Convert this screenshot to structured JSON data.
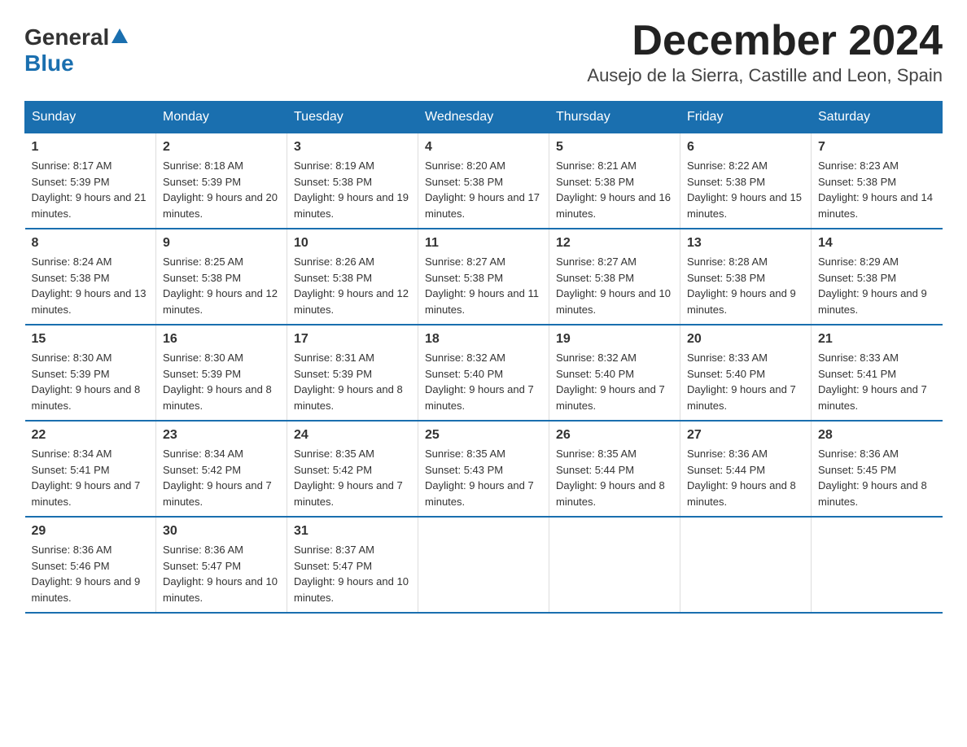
{
  "header": {
    "logo_general": "General",
    "logo_blue": "Blue",
    "month_title": "December 2024",
    "subtitle": "Ausejo de la Sierra, Castille and Leon, Spain"
  },
  "days_of_week": [
    "Sunday",
    "Monday",
    "Tuesday",
    "Wednesday",
    "Thursday",
    "Friday",
    "Saturday"
  ],
  "weeks": [
    [
      {
        "day": "1",
        "sunrise": "8:17 AM",
        "sunset": "5:39 PM",
        "daylight": "9 hours and 21 minutes."
      },
      {
        "day": "2",
        "sunrise": "8:18 AM",
        "sunset": "5:39 PM",
        "daylight": "9 hours and 20 minutes."
      },
      {
        "day": "3",
        "sunrise": "8:19 AM",
        "sunset": "5:38 PM",
        "daylight": "9 hours and 19 minutes."
      },
      {
        "day": "4",
        "sunrise": "8:20 AM",
        "sunset": "5:38 PM",
        "daylight": "9 hours and 17 minutes."
      },
      {
        "day": "5",
        "sunrise": "8:21 AM",
        "sunset": "5:38 PM",
        "daylight": "9 hours and 16 minutes."
      },
      {
        "day": "6",
        "sunrise": "8:22 AM",
        "sunset": "5:38 PM",
        "daylight": "9 hours and 15 minutes."
      },
      {
        "day": "7",
        "sunrise": "8:23 AM",
        "sunset": "5:38 PM",
        "daylight": "9 hours and 14 minutes."
      }
    ],
    [
      {
        "day": "8",
        "sunrise": "8:24 AM",
        "sunset": "5:38 PM",
        "daylight": "9 hours and 13 minutes."
      },
      {
        "day": "9",
        "sunrise": "8:25 AM",
        "sunset": "5:38 PM",
        "daylight": "9 hours and 12 minutes."
      },
      {
        "day": "10",
        "sunrise": "8:26 AM",
        "sunset": "5:38 PM",
        "daylight": "9 hours and 12 minutes."
      },
      {
        "day": "11",
        "sunrise": "8:27 AM",
        "sunset": "5:38 PM",
        "daylight": "9 hours and 11 minutes."
      },
      {
        "day": "12",
        "sunrise": "8:27 AM",
        "sunset": "5:38 PM",
        "daylight": "9 hours and 10 minutes."
      },
      {
        "day": "13",
        "sunrise": "8:28 AM",
        "sunset": "5:38 PM",
        "daylight": "9 hours and 9 minutes."
      },
      {
        "day": "14",
        "sunrise": "8:29 AM",
        "sunset": "5:38 PM",
        "daylight": "9 hours and 9 minutes."
      }
    ],
    [
      {
        "day": "15",
        "sunrise": "8:30 AM",
        "sunset": "5:39 PM",
        "daylight": "9 hours and 8 minutes."
      },
      {
        "day": "16",
        "sunrise": "8:30 AM",
        "sunset": "5:39 PM",
        "daylight": "9 hours and 8 minutes."
      },
      {
        "day": "17",
        "sunrise": "8:31 AM",
        "sunset": "5:39 PM",
        "daylight": "9 hours and 8 minutes."
      },
      {
        "day": "18",
        "sunrise": "8:32 AM",
        "sunset": "5:40 PM",
        "daylight": "9 hours and 7 minutes."
      },
      {
        "day": "19",
        "sunrise": "8:32 AM",
        "sunset": "5:40 PM",
        "daylight": "9 hours and 7 minutes."
      },
      {
        "day": "20",
        "sunrise": "8:33 AM",
        "sunset": "5:40 PM",
        "daylight": "9 hours and 7 minutes."
      },
      {
        "day": "21",
        "sunrise": "8:33 AM",
        "sunset": "5:41 PM",
        "daylight": "9 hours and 7 minutes."
      }
    ],
    [
      {
        "day": "22",
        "sunrise": "8:34 AM",
        "sunset": "5:41 PM",
        "daylight": "9 hours and 7 minutes."
      },
      {
        "day": "23",
        "sunrise": "8:34 AM",
        "sunset": "5:42 PM",
        "daylight": "9 hours and 7 minutes."
      },
      {
        "day": "24",
        "sunrise": "8:35 AM",
        "sunset": "5:42 PM",
        "daylight": "9 hours and 7 minutes."
      },
      {
        "day": "25",
        "sunrise": "8:35 AM",
        "sunset": "5:43 PM",
        "daylight": "9 hours and 7 minutes."
      },
      {
        "day": "26",
        "sunrise": "8:35 AM",
        "sunset": "5:44 PM",
        "daylight": "9 hours and 8 minutes."
      },
      {
        "day": "27",
        "sunrise": "8:36 AM",
        "sunset": "5:44 PM",
        "daylight": "9 hours and 8 minutes."
      },
      {
        "day": "28",
        "sunrise": "8:36 AM",
        "sunset": "5:45 PM",
        "daylight": "9 hours and 8 minutes."
      }
    ],
    [
      {
        "day": "29",
        "sunrise": "8:36 AM",
        "sunset": "5:46 PM",
        "daylight": "9 hours and 9 minutes."
      },
      {
        "day": "30",
        "sunrise": "8:36 AM",
        "sunset": "5:47 PM",
        "daylight": "9 hours and 10 minutes."
      },
      {
        "day": "31",
        "sunrise": "8:37 AM",
        "sunset": "5:47 PM",
        "daylight": "9 hours and 10 minutes."
      },
      null,
      null,
      null,
      null
    ]
  ]
}
